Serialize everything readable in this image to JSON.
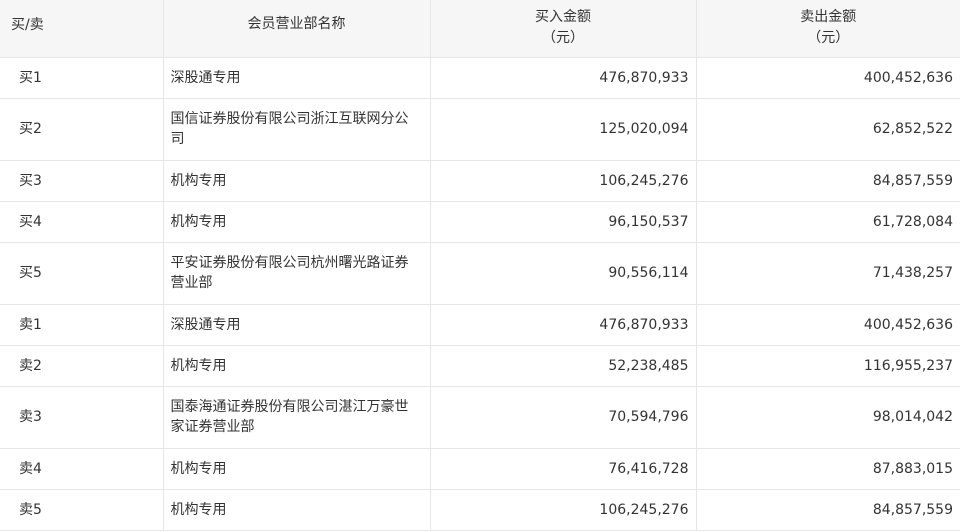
{
  "table": {
    "headers": {
      "type": "买/卖",
      "name": "会员营业部名称",
      "buy_title": "买入金额",
      "buy_unit": "（元）",
      "sell_title": "卖出金额",
      "sell_unit": "（元）"
    },
    "rows": [
      {
        "type": "买1",
        "name": "深股通专用",
        "buy": "476,870,933",
        "sell": "400,452,636"
      },
      {
        "type": "买2",
        "name": "国信证券股份有限公司浙江互联网分公司",
        "buy": "125,020,094",
        "sell": "62,852,522"
      },
      {
        "type": "买3",
        "name": "机构专用",
        "buy": "106,245,276",
        "sell": "84,857,559"
      },
      {
        "type": "买4",
        "name": "机构专用",
        "buy": "96,150,537",
        "sell": "61,728,084"
      },
      {
        "type": "买5",
        "name": "平安证券股份有限公司杭州曙光路证券营业部",
        "buy": "90,556,114",
        "sell": "71,438,257"
      },
      {
        "type": "卖1",
        "name": "深股通专用",
        "buy": "476,870,933",
        "sell": "400,452,636"
      },
      {
        "type": "卖2",
        "name": "机构专用",
        "buy": "52,238,485",
        "sell": "116,955,237"
      },
      {
        "type": "卖3",
        "name": "国泰海通证券股份有限公司湛江万豪世家证券营业部",
        "buy": "70,594,796",
        "sell": "98,014,042"
      },
      {
        "type": "卖4",
        "name": "机构专用",
        "buy": "76,416,728",
        "sell": "87,883,015"
      },
      {
        "type": "卖5",
        "name": "机构专用",
        "buy": "106,245,276",
        "sell": "84,857,559"
      }
    ]
  }
}
